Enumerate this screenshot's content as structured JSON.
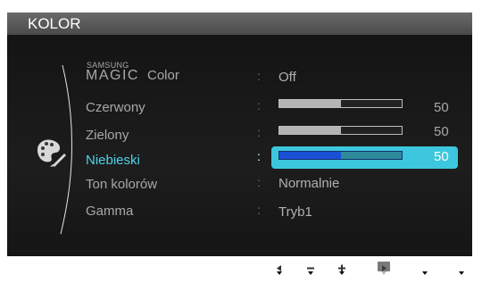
{
  "osd": {
    "title": "KOLOR",
    "menu": {
      "magic_color": {
        "brand_small": "SAMSUNG",
        "brand_big": "MAGIC",
        "label": "Color",
        "value": "Off"
      },
      "red": {
        "label": "Czerwony",
        "value": 50,
        "value_text": "50"
      },
      "green": {
        "label": "Zielony",
        "value": 50,
        "value_text": "50"
      },
      "blue": {
        "label": "Niebieski",
        "value": 50,
        "value_text": "50",
        "selected": true
      },
      "tone": {
        "label": "Ton kolorów",
        "value": "Normalnie"
      },
      "gamma": {
        "label": "Gamma",
        "value": "Tryb1"
      },
      "separator": ":"
    },
    "buttons": {
      "left": "left-arrow-icon",
      "minus": "minus-icon",
      "plus": "plus-icon",
      "enter": "enter-icon",
      "auto": "AUTO",
      "power": "power-icon"
    },
    "colors": {
      "accent": "#3cc7de",
      "selected_fill": "#1a4fd6"
    }
  }
}
